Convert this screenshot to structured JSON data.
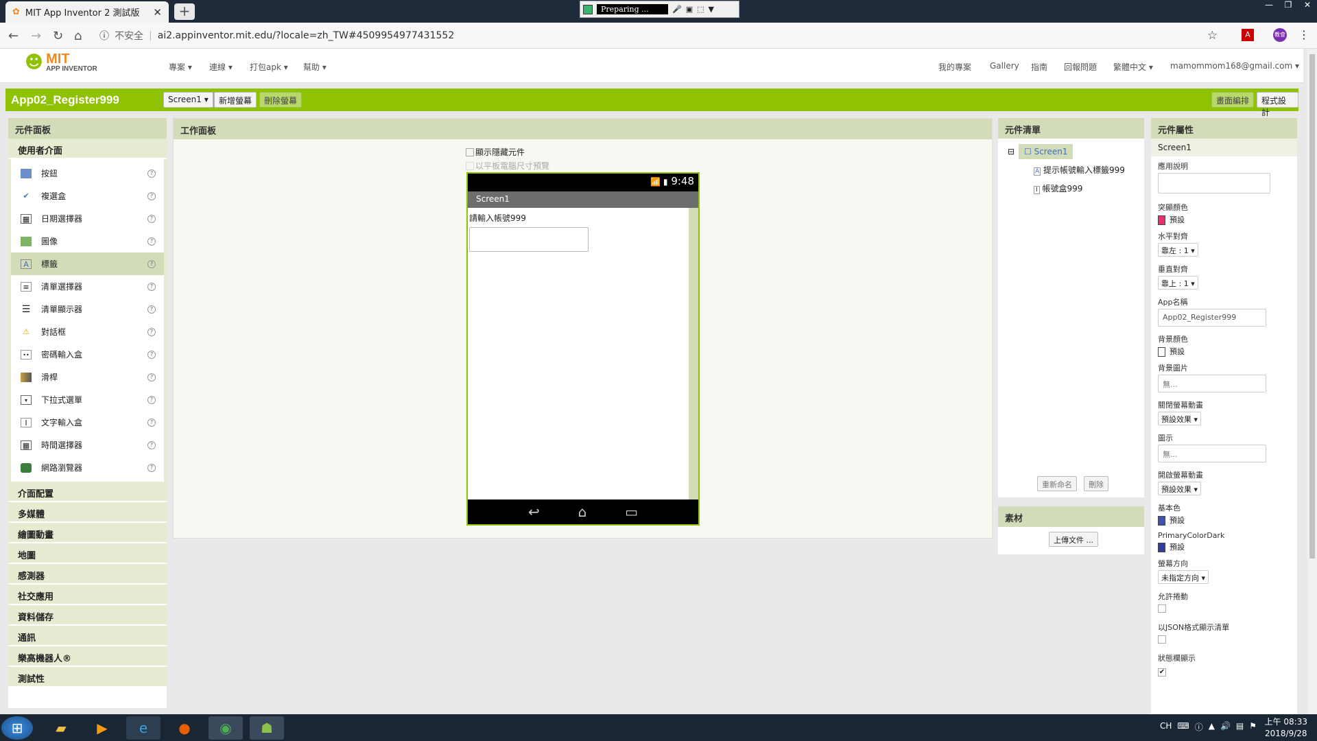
{
  "browser": {
    "tab_title": "MIT App Inventor 2 測試版",
    "tab_close": "✕",
    "new_tab": "+",
    "recorder_text": "Preparing ...",
    "insecure_label": "不安全",
    "url": "ai2.appinventor.mit.edu/?locale=zh_TW#4509954977431552",
    "profile": "教會"
  },
  "header": {
    "logo_mit": "MIT",
    "logo_sub": "APP INVENTOR",
    "menus": [
      "專案 ▾",
      "連線 ▾",
      "打包apk ▾",
      "幫助 ▾"
    ],
    "right_menus": [
      "我的專案",
      "Gallery",
      "指南",
      "回報問題",
      "繁體中文 ▾",
      "mamommom168@gmail.com ▾"
    ]
  },
  "toolbar": {
    "project_name": "App02_Register999",
    "screen_select": "Screen1 ▾",
    "add_screen": "新增螢幕",
    "remove_screen": "刪除螢幕",
    "designer": "畫面編排",
    "blocks": "程式設計"
  },
  "palette": {
    "title": "元件面板",
    "category_open": "使用者介面",
    "items": [
      {
        "label": "按鈕",
        "icon": "button-icon"
      },
      {
        "label": "複選盒",
        "icon": "checkbox-icon"
      },
      {
        "label": "日期選擇器",
        "icon": "datepicker-icon"
      },
      {
        "label": "圖像",
        "icon": "image-icon"
      },
      {
        "label": "標籤",
        "icon": "label-icon"
      },
      {
        "label": "清單選擇器",
        "icon": "listpicker-icon"
      },
      {
        "label": "清單顯示器",
        "icon": "listview-icon"
      },
      {
        "label": "對話框",
        "icon": "notifier-icon"
      },
      {
        "label": "密碼輸入盒",
        "icon": "password-icon"
      },
      {
        "label": "滑桿",
        "icon": "slider-icon"
      },
      {
        "label": "下拉式選單",
        "icon": "spinner-icon"
      },
      {
        "label": "文字輸入盒",
        "icon": "textbox-icon"
      },
      {
        "label": "時間選擇器",
        "icon": "timepicker-icon"
      },
      {
        "label": "網路瀏覽器",
        "icon": "webviewer-icon"
      }
    ],
    "help": "?",
    "categories": [
      "介面配置",
      "多媒體",
      "繪圖動畫",
      "地圖",
      "感測器",
      "社交應用",
      "資料儲存",
      "通訊",
      "樂高機器人®",
      "測試性"
    ]
  },
  "viewer": {
    "title": "工作面板",
    "show_hidden": "顯示隱藏元件",
    "tablet_preview": "以平板電腦尺寸預覽",
    "time": "9:48",
    "screen_title": "Screen1",
    "label_text": "請輸入帳號999"
  },
  "tree": {
    "title": "元件清單",
    "root": "Screen1",
    "children": [
      "提示帳號輸入標籤999",
      "帳號盒999"
    ],
    "rename": "重新命名",
    "delete": "刪除",
    "collapse": "⊟"
  },
  "media": {
    "title": "素材",
    "upload": "上傳文件 ..."
  },
  "properties": {
    "title": "元件屬性",
    "component": "Screen1",
    "about_label": "應用說明",
    "accent_label": "突顯顏色",
    "accent_value": "預設",
    "accent_color": "#e8316b",
    "halign_label": "水平對齊",
    "halign_value": "靠左 : 1 ▾",
    "valign_label": "垂直對齊",
    "valign_value": "靠上 : 1 ▾",
    "appname_label": "App名稱",
    "appname_value": "App02_Register999",
    "bgcolor_label": "背景顏色",
    "bgcolor_value": "預設",
    "bgimage_label": "背景圖片",
    "bgimage_value": "無...",
    "close_anim_label": "關閉螢幕動畫",
    "close_anim_value": "預設效果 ▾",
    "icon_label": "圖示",
    "icon_value": "無...",
    "open_anim_label": "開啟螢幕動畫",
    "open_anim_value": "預設效果 ▾",
    "primary_label": "基本色",
    "primary_value": "預設",
    "primary_color": "#3f51b5",
    "primarydark_label": "PrimaryColorDark",
    "primarydark_value": "預設",
    "primarydark_color": "#303f9f",
    "orientation_label": "螢幕方向",
    "orientation_value": "未指定方向 ▾",
    "scrollable_label": "允許捲動",
    "json_label": "以JSON格式顯示清單",
    "statusbar_label": "狀態欄顯示",
    "check": "✔"
  },
  "taskbar": {
    "tray": [
      "CH",
      "▲"
    ],
    "time": "上午 08:33",
    "date": "2018/9/28"
  }
}
